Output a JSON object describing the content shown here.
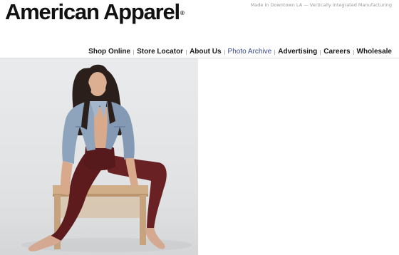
{
  "header": {
    "logo_text": "American Apparel",
    "logo_mark": "®",
    "tagline": "Made in Downtown LA — Vertically Integrated Manufacturing"
  },
  "nav": {
    "items": [
      {
        "label": "Shop Online",
        "active": false
      },
      {
        "label": "Store Locator",
        "active": false
      },
      {
        "label": "About Us",
        "active": false
      },
      {
        "label": "Photo Archive",
        "active": true
      },
      {
        "label": "Advertising",
        "active": false
      },
      {
        "label": "Careers",
        "active": false
      },
      {
        "label": "Wholesale",
        "active": false
      }
    ]
  },
  "photo": {
    "subject": "model-seated-on-wooden-bench",
    "colors": {
      "backdrop": "#e6e8ea",
      "jacket": "#8ea3bc",
      "pants": "#5e1b1e",
      "bench": "#cfae88"
    }
  },
  "colors": {
    "active_nav": "#3b4a8a",
    "nav_text": "#1a1a1a",
    "tagline": "#9a9a9a"
  }
}
